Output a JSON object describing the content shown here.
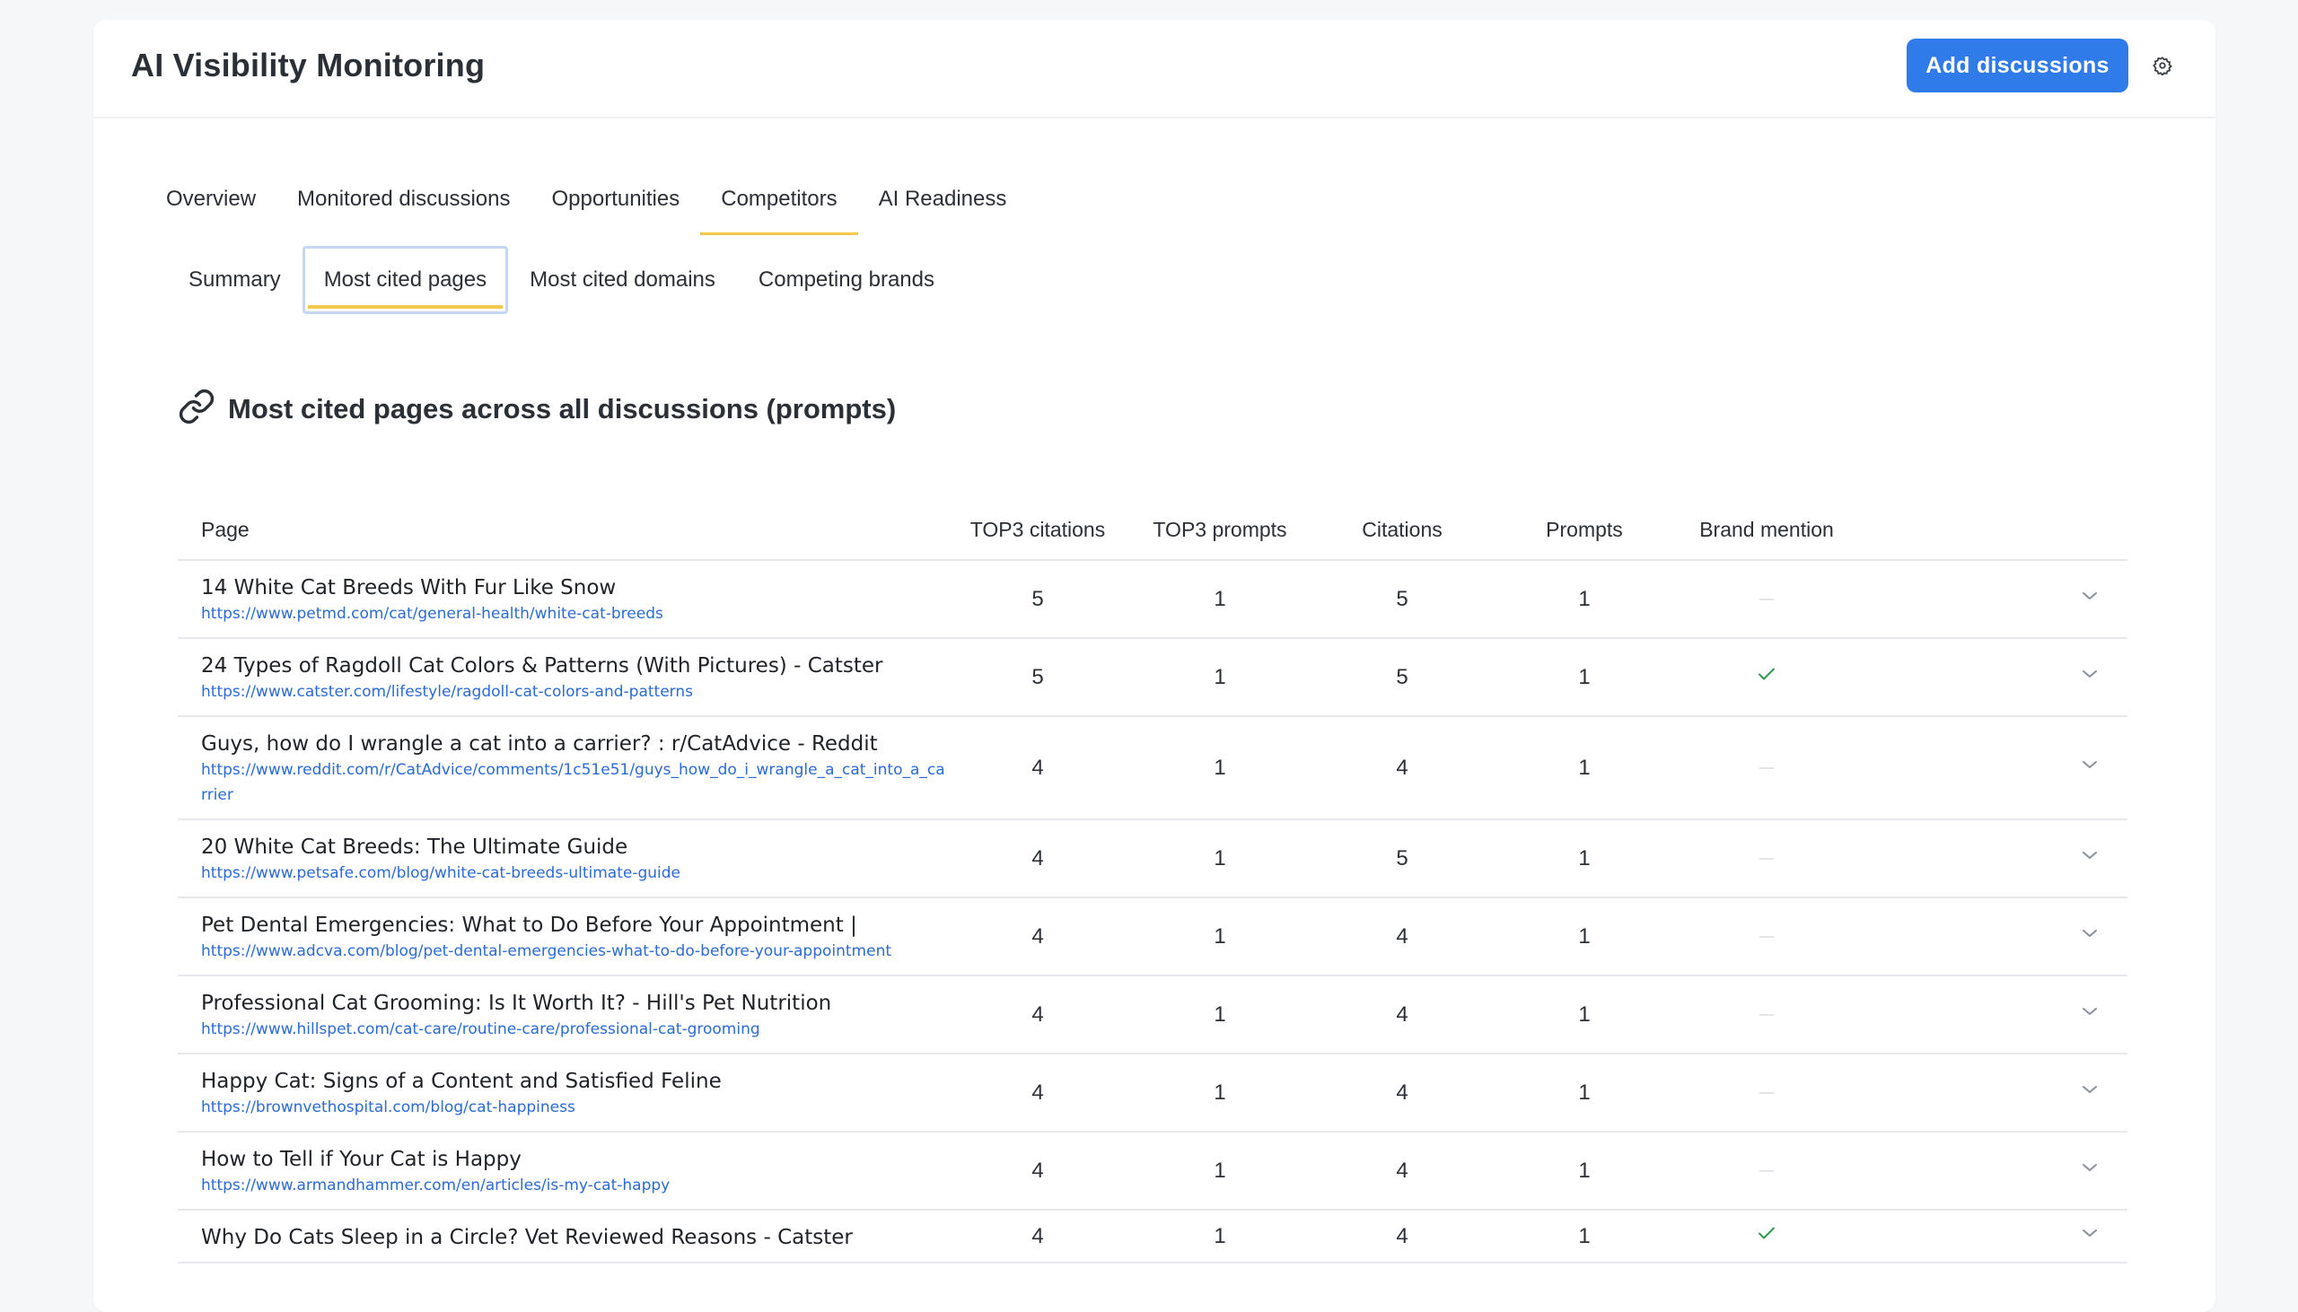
{
  "header": {
    "title": "AI Visibility Monitoring",
    "add_button": "Add discussions",
    "settings_icon": "gear-icon"
  },
  "tabs": [
    {
      "label": "Overview"
    },
    {
      "label": "Monitored discussions"
    },
    {
      "label": "Opportunities"
    },
    {
      "label": "Competitors",
      "active": true
    },
    {
      "label": "AI Readiness"
    }
  ],
  "subtabs": [
    {
      "label": "Summary"
    },
    {
      "label": "Most cited pages",
      "active": true
    },
    {
      "label": "Most cited domains"
    },
    {
      "label": "Competing brands"
    }
  ],
  "section": {
    "title": "Most cited pages across all discussions (prompts)",
    "icon": "link-icon"
  },
  "table": {
    "columns": [
      "Page",
      "TOP3 citations",
      "TOP3 prompts",
      "Citations",
      "Prompts",
      "Brand mention"
    ],
    "rows": [
      {
        "title": "14 White Cat Breeds With Fur Like Snow",
        "url": "https://www.petmd.com/cat/general-health/white-cat-breeds",
        "top3_citations": "5",
        "top3_prompts": "1",
        "citations": "5",
        "prompts": "1",
        "brand_mention": false
      },
      {
        "title": "24 Types of Ragdoll Cat Colors & Patterns (With Pictures) - Catster",
        "url": "https://www.catster.com/lifestyle/ragdoll-cat-colors-and-patterns",
        "top3_citations": "5",
        "top3_prompts": "1",
        "citations": "5",
        "prompts": "1",
        "brand_mention": true
      },
      {
        "title": "Guys, how do I wrangle a cat into a carrier? : r/CatAdvice - Reddit",
        "url": "https://www.reddit.com/r/CatAdvice/comments/1c51e51/guys_how_do_i_wrangle_a_cat_into_a_carrier",
        "top3_citations": "4",
        "top3_prompts": "1",
        "citations": "4",
        "prompts": "1",
        "brand_mention": false
      },
      {
        "title": "20 White Cat Breeds: The Ultimate Guide",
        "url": "https://www.petsafe.com/blog/white-cat-breeds-ultimate-guide",
        "top3_citations": "4",
        "top3_prompts": "1",
        "citations": "5",
        "prompts": "1",
        "brand_mention": false
      },
      {
        "title": "Pet Dental Emergencies: What to Do Before Your Appointment |",
        "url": "https://www.adcva.com/blog/pet-dental-emergencies-what-to-do-before-your-appointment",
        "top3_citations": "4",
        "top3_prompts": "1",
        "citations": "4",
        "prompts": "1",
        "brand_mention": false
      },
      {
        "title": "Professional Cat Grooming: Is It Worth It? - Hill's Pet Nutrition",
        "url": "https://www.hillspet.com/cat-care/routine-care/professional-cat-grooming",
        "top3_citations": "4",
        "top3_prompts": "1",
        "citations": "4",
        "prompts": "1",
        "brand_mention": false
      },
      {
        "title": "Happy Cat: Signs of a Content and Satisfied Feline",
        "url": "https://brownvethospital.com/blog/cat-happiness",
        "top3_citations": "4",
        "top3_prompts": "1",
        "citations": "4",
        "prompts": "1",
        "brand_mention": false
      },
      {
        "title": "How to Tell if Your Cat is Happy",
        "url": "https://www.armandhammer.com/en/articles/is-my-cat-happy",
        "top3_citations": "4",
        "top3_prompts": "1",
        "citations": "4",
        "prompts": "1",
        "brand_mention": false
      },
      {
        "title": "Why Do Cats Sleep in a Circle? Vet Reviewed Reasons - Catster",
        "url": "",
        "top3_citations": "4",
        "top3_prompts": "1",
        "citations": "4",
        "prompts": "1",
        "brand_mention": true
      }
    ]
  },
  "colors": {
    "accent": "#2f7bea",
    "tab_underline": "#f2c94c",
    "link": "#2a6bd6",
    "check": "#2e9a4e"
  }
}
